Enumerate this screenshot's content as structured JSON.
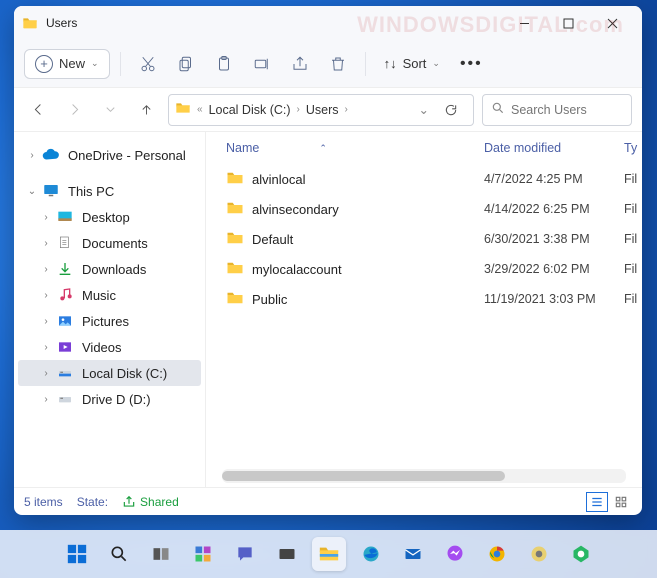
{
  "window": {
    "title": "Users",
    "watermark": "WINDOWSDIGITAL.com"
  },
  "toolbar": {
    "new_label": "New",
    "sort_label": "Sort"
  },
  "breadcrumb": {
    "root": "«",
    "segments": [
      "Local Disk (C:)",
      "Users"
    ]
  },
  "search": {
    "placeholder": "Search Users"
  },
  "sidebar": {
    "onedrive": "OneDrive - Personal",
    "thispc": "This PC",
    "items": [
      {
        "label": "Desktop"
      },
      {
        "label": "Documents"
      },
      {
        "label": "Downloads"
      },
      {
        "label": "Music"
      },
      {
        "label": "Pictures"
      },
      {
        "label": "Videos"
      },
      {
        "label": "Local Disk (C:)"
      },
      {
        "label": "Drive D (D:)"
      }
    ]
  },
  "columns": {
    "name": "Name",
    "date": "Date modified",
    "type": "Ty"
  },
  "rows": [
    {
      "name": "alvinlocal",
      "date": "4/7/2022 4:25 PM",
      "type": "Fil"
    },
    {
      "name": "alvinsecondary",
      "date": "4/14/2022 6:25 PM",
      "type": "Fil"
    },
    {
      "name": "Default",
      "date": "6/30/2021 3:38 PM",
      "type": "Fil"
    },
    {
      "name": "mylocalaccount",
      "date": "3/29/2022 6:02 PM",
      "type": "Fil"
    },
    {
      "name": "Public",
      "date": "11/19/2021 3:03 PM",
      "type": "Fil"
    }
  ],
  "status": {
    "items": "5 items",
    "state_label": "State:",
    "state_value": "Shared"
  }
}
